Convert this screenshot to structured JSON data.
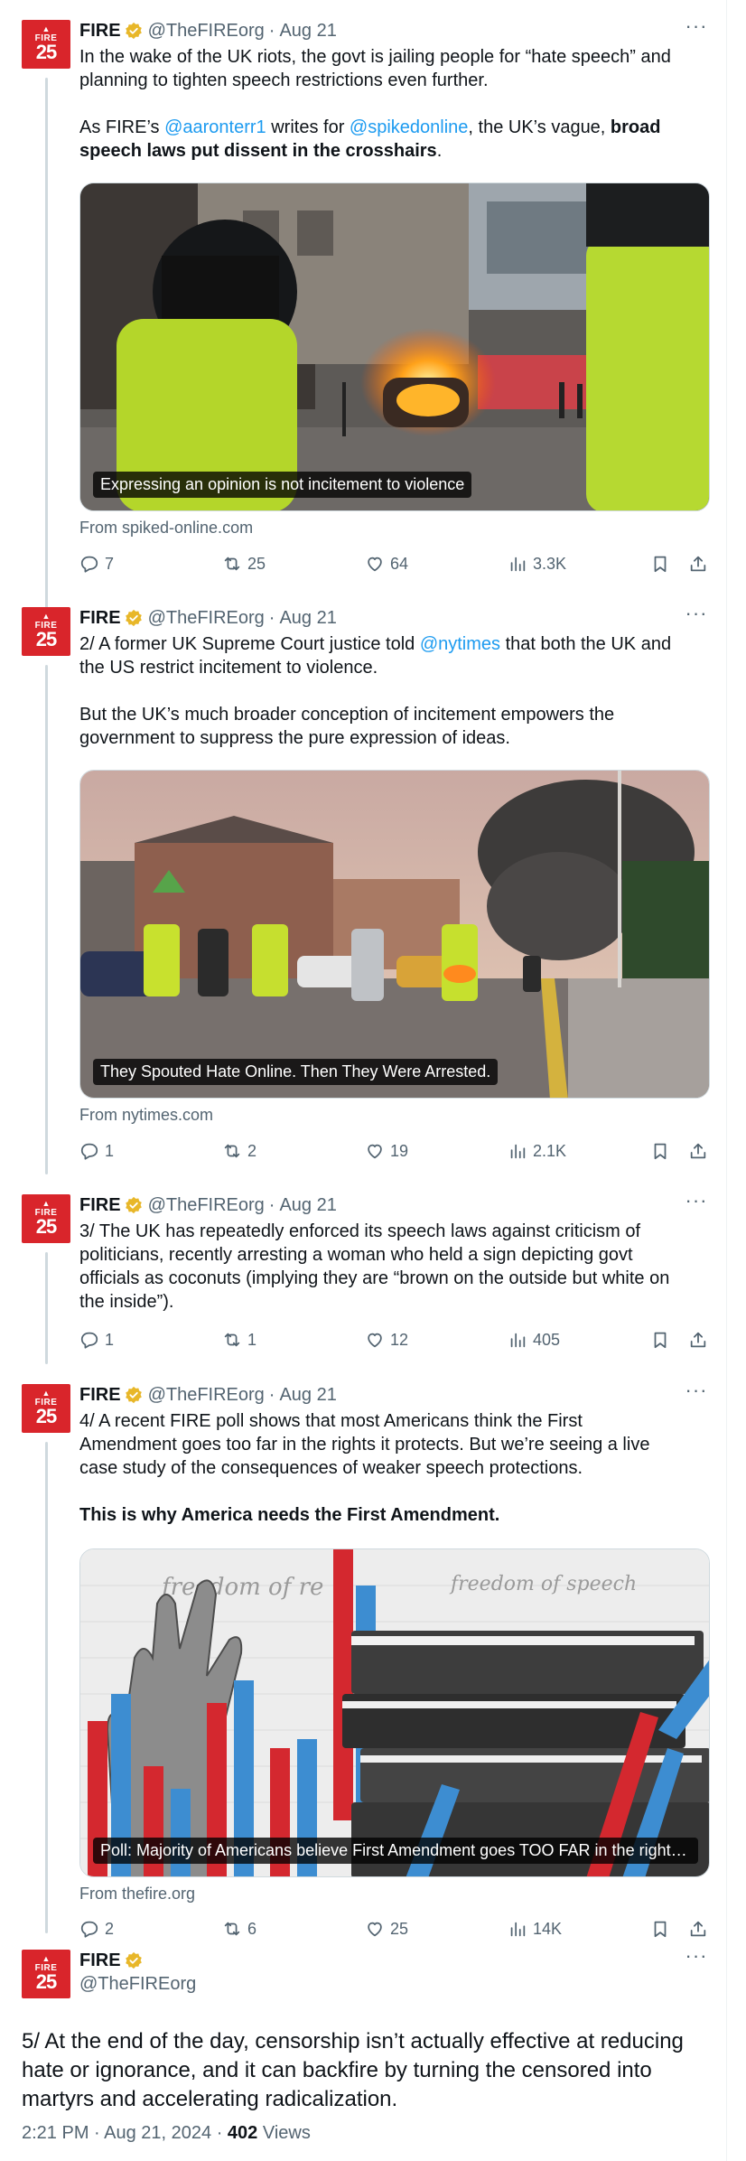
{
  "account": {
    "name": "FIRE",
    "handle": "@TheFIREorg",
    "avatar_text_top": "FIRE",
    "avatar_text_num": "25",
    "brand_color": "#d9252b",
    "verified_color": "#e8b729"
  },
  "colors": {
    "link": "#1d9bf0",
    "muted": "#536471",
    "text": "#0f1419"
  },
  "tweets": [
    {
      "date": "Aug 21",
      "text_lines": [
        "In the wake of the UK riots, the govt is jailing people for “hate speech” and",
        "planning to tighten speech restrictions even further."
      ],
      "p2_prefix": "As FIRE’s ",
      "p2_mention1": "@aaronterr1",
      "p2_mid": " writes for ",
      "p2_mention2": "@spikedonline",
      "p2_after": ", the UK’s vague, ",
      "p2_bold1": "broad",
      "p2_bold2": "speech laws put dissent in the crosshairs",
      "p2_end": ".",
      "card_caption": "Expressing an opinion is not incitement to violence",
      "card_source": "From spiked-online.com",
      "replies": "7",
      "reposts": "25",
      "likes": "64",
      "views": "3.3K"
    },
    {
      "date": "Aug 21",
      "line1_prefix": "2/ A former UK Supreme Court justice told ",
      "line1_mention": "@nytimes",
      "line1_suffix": " that both the UK and",
      "line2": "the US restrict incitement to violence.",
      "p2_lines": [
        "But the UK’s much broader conception of incitement empowers the",
        "government to suppress the pure expression of ideas."
      ],
      "card_caption": "They Spouted Hate Online. Then They Were Arrested.",
      "card_source": "From nytimes.com",
      "replies": "1",
      "reposts": "2",
      "likes": "19",
      "views": "2.1K"
    },
    {
      "date": "Aug 21",
      "text_lines": [
        "3/ The UK has repeatedly enforced its speech laws against criticism of",
        "politicians, recently arresting a woman who held a sign depicting govt",
        "officials as coconuts (implying they are “brown on the outside but white on",
        "the inside”)."
      ],
      "replies": "1",
      "reposts": "1",
      "likes": "12",
      "views": "405"
    },
    {
      "date": "Aug 21",
      "text_lines": [
        "4/ A recent FIRE poll shows that most Americans think the First",
        "Amendment goes too far in the rights it protects. But we’re seeing a live",
        "case study of the consequences of weaker speech protections."
      ],
      "bold_line": "This is why America needs the First Amendment.",
      "card_caption": "Poll: Majority of Americans believe First Amendment goes TOO FAR in the rights ...",
      "card_source": "From thefire.org",
      "card_script_text1": "freedom of re",
      "card_script_text2": "freedom of speech",
      "replies": "2",
      "reposts": "6",
      "likes": "25",
      "views": "14K"
    }
  ],
  "main_tweet": {
    "text_lines": [
      "5/ At the end of the day, censorship isn’t actually effective at reducing",
      "hate or ignorance, and it can backfire by turning the censored into",
      "martyrs and accelerating radicalization."
    ],
    "timestamp": "2:21 PM · Aug 21, 2024 · ",
    "views_count": "402",
    "views_label": " Views"
  },
  "icons": [
    "reply-icon",
    "repost-icon",
    "like-icon",
    "views-icon",
    "bookmark-icon",
    "share-icon",
    "more-icon",
    "verified-badge-icon"
  ]
}
